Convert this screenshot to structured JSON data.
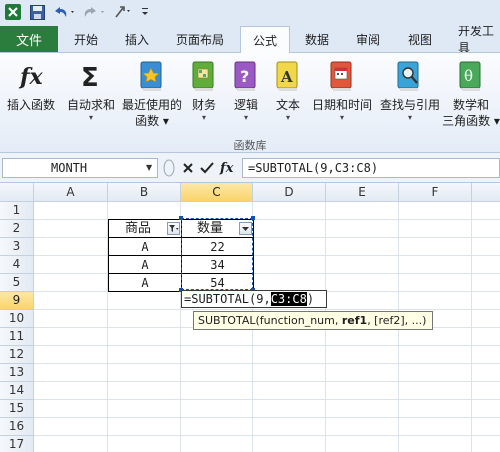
{
  "qat": {
    "icons": [
      "excel-logo-icon",
      "save-icon",
      "undo-icon",
      "redo-icon",
      "customize-icon"
    ]
  },
  "tabs": {
    "file": "文件",
    "items": [
      "开始",
      "插入",
      "页面布局",
      "公式",
      "数据",
      "审阅",
      "视图",
      "开发工具"
    ],
    "active": "公式"
  },
  "ribbon": {
    "buttons": [
      {
        "label": "插入函数",
        "line2": "",
        "icon": "fx-icon"
      },
      {
        "label": "自动求和",
        "line2": "▾",
        "icon": "sigma-icon"
      },
      {
        "label": "最近使用的",
        "line2": "函数 ▾",
        "icon": "recent-book-icon"
      },
      {
        "label": "财务",
        "line2": "▾",
        "icon": "finance-book-icon"
      },
      {
        "label": "逻辑",
        "line2": "▾",
        "icon": "logic-book-icon"
      },
      {
        "label": "文本",
        "line2": "▾",
        "icon": "text-book-icon"
      },
      {
        "label": "日期和时间",
        "line2": "▾",
        "icon": "datetime-book-icon"
      },
      {
        "label": "查找与引用",
        "line2": "▾",
        "icon": "lookup-book-icon"
      },
      {
        "label": "数学和",
        "line2": "三角函数 ▾",
        "icon": "math-book-icon"
      }
    ],
    "group_label": "函数库"
  },
  "formula_bar": {
    "name_box": "MONTH",
    "formula": "=SUBTOTAL(9,C3:C8)",
    "fx_label": "fx"
  },
  "grid": {
    "columns": [
      "A",
      "B",
      "C",
      "D",
      "E",
      "F"
    ],
    "rows": [
      "1",
      "2",
      "3",
      "4",
      "5",
      "9",
      "10",
      "11",
      "12",
      "13",
      "14",
      "15",
      "16",
      "17"
    ],
    "header_row": {
      "b": "商品",
      "c": "数量"
    },
    "data_rows": [
      {
        "b": "A",
        "c": "22"
      },
      {
        "b": "A",
        "c": "34"
      },
      {
        "b": "A",
        "c": "54"
      }
    ],
    "edit_cell": {
      "prefix": "=SUBTOTAL(9,",
      "highlight": "C3:C8",
      "suffix": ")"
    },
    "tooltip": {
      "fn": "SUBTOTAL(function_num, ",
      "bold_arg": "ref1",
      "rest": ", [ref2], ...)"
    }
  }
}
